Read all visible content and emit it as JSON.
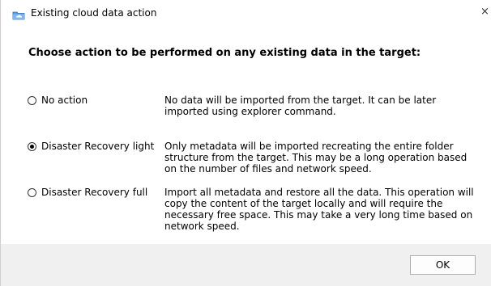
{
  "window": {
    "title": "Existing cloud data action",
    "close_glyph": "×",
    "app_icon": "cloud-folder-icon"
  },
  "heading": "Choose action to be performed on any existing data in the target:",
  "options": [
    {
      "label": "No action",
      "checked": false,
      "description": "No data will be imported from the target. It can be later imported using explorer command."
    },
    {
      "label": "Disaster Recovery light",
      "checked": true,
      "description": "Only metadata will be imported recreating the entire folder structure from the target. This may be a long operation based on the number of files and network speed."
    },
    {
      "label": "Disaster Recovery full",
      "checked": false,
      "description": "Import all metadata and restore all the data. This operation will copy the content of the target locally and will require the necessary free space. This may take a very long time based on network speed."
    }
  ],
  "footer": {
    "ok_label": "OK"
  },
  "colors": {
    "footer_bg": "#f0f0f0",
    "icon_blue": "#1e88e5"
  }
}
